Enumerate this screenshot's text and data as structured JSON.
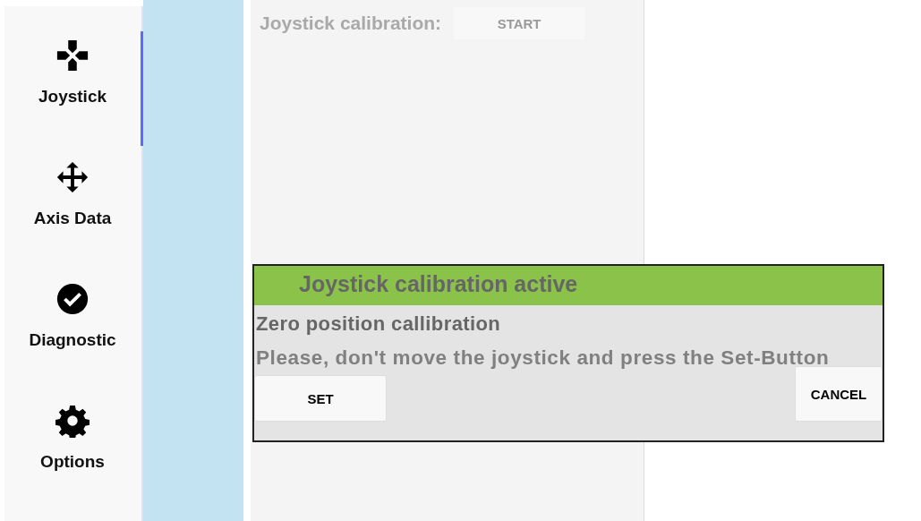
{
  "sidebar": {
    "items": [
      {
        "kind": "gamepad",
        "label": "Joystick",
        "selected": true
      },
      {
        "kind": "move",
        "label": "Axis Data",
        "selected": false
      },
      {
        "kind": "check",
        "label": "Diagnostic",
        "selected": false
      },
      {
        "kind": "gear",
        "label": "Options",
        "selected": false
      }
    ]
  },
  "content": {
    "calibration_label": "Joystick calibration:",
    "start_button": "START"
  },
  "dialog": {
    "title": "Joystick calibration active",
    "heading": "Zero position callibration",
    "message": "Please, don't move the joystick and press the Set-Button",
    "set_button": "SET",
    "cancel_button": "CANCEL"
  }
}
